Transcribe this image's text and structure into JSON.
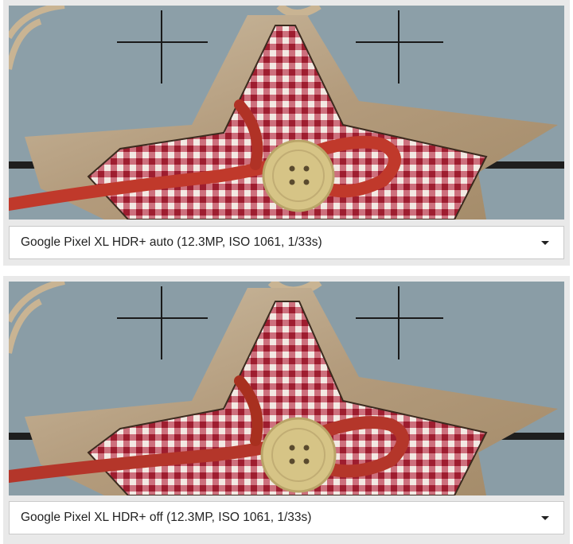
{
  "comparisons": [
    {
      "photo_subject": "Wooden star ornament with red gingham fabric, twine and a wooden button",
      "select": {
        "value": "Google Pixel XL HDR+ auto (12.3MP, ISO 1061, 1/33s)",
        "icon": "chevron-down-icon"
      }
    },
    {
      "photo_subject": "Wooden star ornament with red gingham fabric, twine and a wooden button",
      "select": {
        "value": "Google Pixel XL HDR+ off (12.3MP, ISO 1061, 1/33s)",
        "icon": "chevron-down-icon"
      }
    }
  ],
  "colors": {
    "background": "#8a9da6",
    "wood": "#b7a083",
    "fabric_red": "#b02a3a",
    "twine_red": "#c0392b",
    "button": "#d9c78d"
  }
}
